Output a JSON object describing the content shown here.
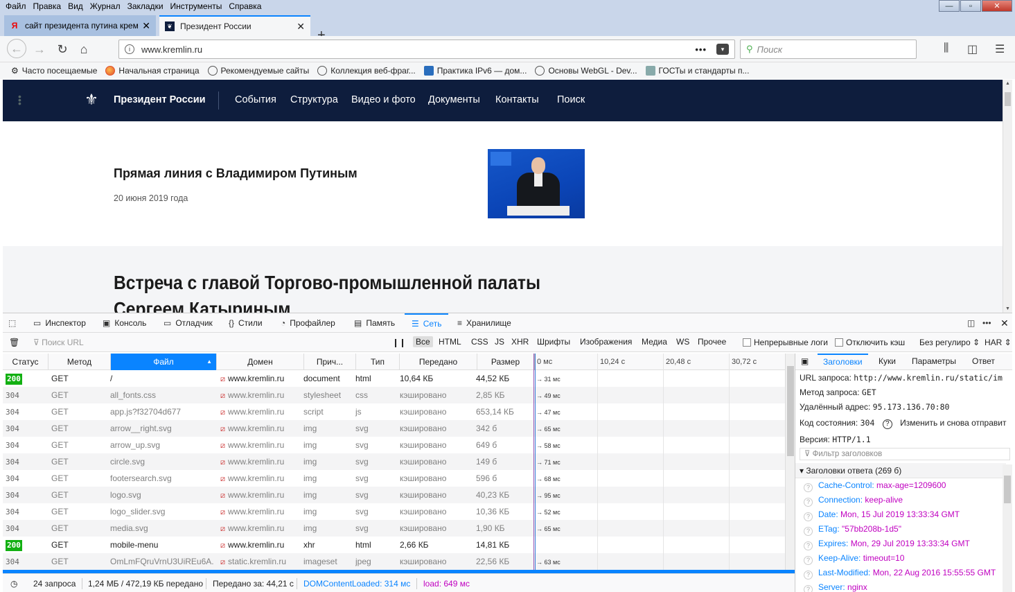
{
  "menubar": {
    "items": [
      "Файл",
      "Правка",
      "Вид",
      "Журнал",
      "Закладки",
      "Инструменты",
      "Справка"
    ]
  },
  "tabs": [
    {
      "label": "сайт президента путина кремл",
      "active": false
    },
    {
      "label": "Президент России",
      "active": true
    }
  ],
  "navbar": {
    "url": "www.kremlin.ru",
    "search_placeholder": "Поиск"
  },
  "bookmarks": [
    "Часто посещаемые",
    "Начальная страница",
    "Рекомендуемые сайты",
    "Коллекция веб-фраг...",
    "Практика IPv6 — дом...",
    "Основы WebGL - Dev...",
    "ГОСТы и стандарты п..."
  ],
  "site": {
    "title": "Президент России",
    "nav": [
      "События",
      "Структура",
      "Видео и фото",
      "Документы",
      "Контакты",
      "Поиск"
    ],
    "news1": {
      "title": "Прямая линия с Владимиром Путиным",
      "date": "20 июня 2019 года"
    },
    "news2": {
      "title_line1": "Встреча с главой Торгово-промышленной палаты",
      "title_line2": "Сергеем Катыриным"
    }
  },
  "devtools": {
    "tabs": [
      "Инспектор",
      "Консоль",
      "Отладчик",
      "Стили",
      "Профайлер",
      "Память",
      "Сеть",
      "Хранилище"
    ],
    "active_tab": "Сеть",
    "filter_placeholder": "Поиск URL",
    "type_filters": [
      "Все",
      "HTML",
      "CSS",
      "JS",
      "XHR",
      "Шрифты",
      "Изображения",
      "Медиа",
      "WS",
      "Прочее"
    ],
    "options": {
      "persist_logs": "Непрерывные логи",
      "disable_cache": "Отключить кэш",
      "throttling": "Без регулиро",
      "har": "HAR"
    },
    "columns": [
      "Статус",
      "Метод",
      "Файл",
      "Домен",
      "Прич...",
      "Тип",
      "Передано",
      "Размер"
    ],
    "timeline_ticks": [
      "0 мс",
      "10,24 с",
      "20,48 с",
      "30,72 с"
    ],
    "requests": [
      {
        "status": "200",
        "method": "GET",
        "file": "/",
        "domain": "www.kremlin.ru",
        "cause": "document",
        "type": "html",
        "transferred": "10,64 КБ",
        "size": "44,52 КБ",
        "time": "→ 31 мс"
      },
      {
        "status": "304",
        "method": "GET",
        "file": "all_fonts.css",
        "domain": "www.kremlin.ru",
        "cause": "stylesheet",
        "type": "css",
        "transferred": "кэшировано",
        "size": "2,85 КБ",
        "time": "→ 49 мс"
      },
      {
        "status": "304",
        "method": "GET",
        "file": "app.js?f32704d677",
        "domain": "www.kremlin.ru",
        "cause": "script",
        "type": "js",
        "transferred": "кэшировано",
        "size": "653,14 КБ",
        "time": "→ 47 мс"
      },
      {
        "status": "304",
        "method": "GET",
        "file": "arrow__right.svg",
        "domain": "www.kremlin.ru",
        "cause": "img",
        "type": "svg",
        "transferred": "кэшировано",
        "size": "342 б",
        "time": "→ 65 мс"
      },
      {
        "status": "304",
        "method": "GET",
        "file": "arrow_up.svg",
        "domain": "www.kremlin.ru",
        "cause": "img",
        "type": "svg",
        "transferred": "кэшировано",
        "size": "649 б",
        "time": "→ 58 мс"
      },
      {
        "status": "304",
        "method": "GET",
        "file": "circle.svg",
        "domain": "www.kremlin.ru",
        "cause": "img",
        "type": "svg",
        "transferred": "кэшировано",
        "size": "149 б",
        "time": "→ 71 мс"
      },
      {
        "status": "304",
        "method": "GET",
        "file": "footersearch.svg",
        "domain": "www.kremlin.ru",
        "cause": "img",
        "type": "svg",
        "transferred": "кэшировано",
        "size": "596 б",
        "time": "→ 68 мс"
      },
      {
        "status": "304",
        "method": "GET",
        "file": "logo.svg",
        "domain": "www.kremlin.ru",
        "cause": "img",
        "type": "svg",
        "transferred": "кэшировано",
        "size": "40,23 КБ",
        "time": "→ 95 мс"
      },
      {
        "status": "304",
        "method": "GET",
        "file": "logo_slider.svg",
        "domain": "www.kremlin.ru",
        "cause": "img",
        "type": "svg",
        "transferred": "кэшировано",
        "size": "10,36 КБ",
        "time": "→ 52 мс"
      },
      {
        "status": "304",
        "method": "GET",
        "file": "media.svg",
        "domain": "www.kremlin.ru",
        "cause": "img",
        "type": "svg",
        "transferred": "кэшировано",
        "size": "1,90 КБ",
        "time": "→ 65 мс"
      },
      {
        "status": "200",
        "method": "GET",
        "file": "mobile-menu",
        "domain": "www.kremlin.ru",
        "cause": "xhr",
        "type": "html",
        "transferred": "2,66 КБ",
        "size": "14,81 КБ",
        "time": ""
      },
      {
        "status": "304",
        "method": "GET",
        "file": "OmLmFQruVrnU3UiREu6A...",
        "domain": "static.kremlin.ru",
        "cause": "imageset",
        "type": "jpeg",
        "transferred": "кэшировано",
        "size": "22,56 КБ",
        "time": "→ 63 мс"
      }
    ],
    "statusbar": {
      "requests": "24 запроса",
      "transferred": "1,24 МБ / 472,19 КБ передано",
      "finish": "Передано за: 44,21 с",
      "dcl": "DOMContentLoaded: 314 мс",
      "load": "load: 649 мс"
    },
    "side": {
      "tabs": [
        "Заголовки",
        "Куки",
        "Параметры",
        "Ответ"
      ],
      "request_url_label": "URL запроса:",
      "request_url": "http://www.kremlin.ru/static/im",
      "method_label": "Метод запроса:",
      "method": "GET",
      "remote_label": "Удалённый адрес:",
      "remote": "95.173.136.70:80",
      "status_label": "Код состояния:",
      "status": "304",
      "edit_resend": "Изменить и снова отправит",
      "version_label": "Версия:",
      "version": "HTTP/1.1",
      "filter_placeholder": "Фильтр заголовков",
      "response_headers_title": "Заголовки ответа (269 б)",
      "headers": [
        {
          "name": "Cache-Control:",
          "value": "max-age=1209600"
        },
        {
          "name": "Connection:",
          "value": "keep-alive"
        },
        {
          "name": "Date:",
          "value": "Mon, 15 Jul 2019 13:33:34 GMT"
        },
        {
          "name": "ETag:",
          "value": "\"57bb208b-1d5\""
        },
        {
          "name": "Expires:",
          "value": "Mon, 29 Jul 2019 13:33:34 GMT"
        },
        {
          "name": "Keep-Alive:",
          "value": "timeout=10"
        },
        {
          "name": "Last-Modified:",
          "value": "Mon, 22 Aug 2016 15:55:55 GMT"
        },
        {
          "name": "Server:",
          "value": "nginx"
        }
      ]
    }
  },
  "colors": {
    "accent": "#0a84ff",
    "status_ok": "#12b012",
    "site_header": "#0e1d3d",
    "header_value": "#c000c0"
  }
}
